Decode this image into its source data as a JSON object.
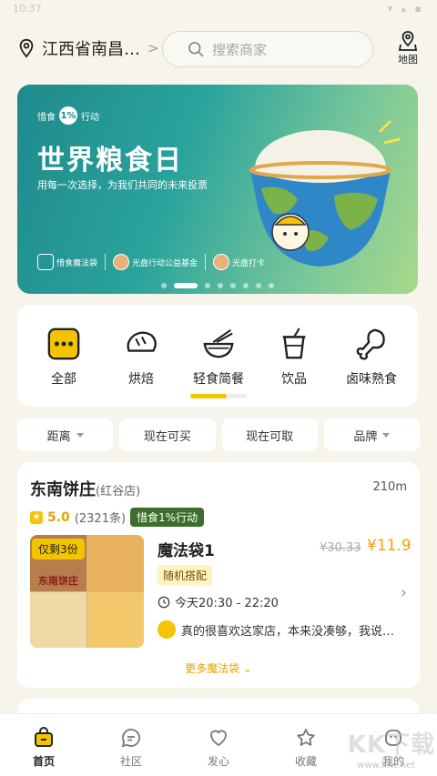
{
  "status_bar": {
    "time": "10:37",
    "icons": "▾ ▴ ▪"
  },
  "header": {
    "location": "江西省南昌…",
    "location_chevron": ">",
    "search_placeholder": "搜索商家",
    "map_label": "地图"
  },
  "banner": {
    "tag_left": "惜食",
    "tag_pct": "1%",
    "tag_right": "行动",
    "title": "世界粮食日",
    "subtitle": "用每一次选择，为我们共同的未来投票",
    "partners": [
      "惜食魔法袋",
      "光盘行动公益基金",
      "光盘打卡"
    ],
    "dots": 8,
    "active_dot": 1
  },
  "categories": [
    {
      "label": "全部",
      "icon": "all-icon"
    },
    {
      "label": "烘焙",
      "icon": "bread-icon"
    },
    {
      "label": "轻食简餐",
      "icon": "noodle-bowl-icon"
    },
    {
      "label": "饮品",
      "icon": "drink-cup-icon"
    },
    {
      "label": "卤味熟食",
      "icon": "drumstick-icon"
    }
  ],
  "filters": [
    {
      "label": "距离",
      "caret": true
    },
    {
      "label": "现在可买",
      "caret": false
    },
    {
      "label": "现在可取",
      "caret": false
    },
    {
      "label": "品牌",
      "caret": true
    }
  ],
  "store": {
    "name": "东南饼庄",
    "branch": "(红谷店)",
    "distance": "210m",
    "rating": "5.0",
    "reviews": "(2321条)",
    "action_tag": "惜食1%行动",
    "thumb_sign": "东南饼庄",
    "stock_badge": "仅剩3份",
    "bag_title": "魔法袋1",
    "bag_tag": "随机搭配",
    "old_price": "¥30.33",
    "new_price": "¥11.9",
    "pickup_time": "今天20:30 - 22:20",
    "review_snippet": "真的很喜欢这家店，本来没凑够，我说…",
    "more_label": "更多魔法袋 ⌄"
  },
  "tabbar": [
    {
      "label": "首页",
      "icon": "home-bag-icon",
      "active": true
    },
    {
      "label": "社区",
      "icon": "chat-bubble-icon",
      "active": false
    },
    {
      "label": "发心",
      "icon": "heart-icon",
      "active": false
    },
    {
      "label": "收藏",
      "icon": "star-icon",
      "active": false
    },
    {
      "label": "我的",
      "icon": "profile-icon",
      "active": false
    }
  ],
  "watermark": {
    "text": "KK下载",
    "url": "www.kkx.net"
  },
  "colors": {
    "accent": "#f5c400",
    "price": "#f5a100",
    "green_tag": "#3c6d2a",
    "background": "#f7f4ec"
  }
}
